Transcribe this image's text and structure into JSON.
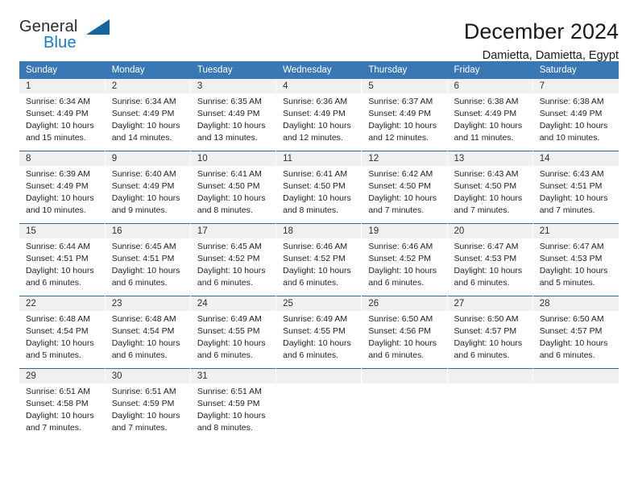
{
  "brand": {
    "name_part1": "General",
    "name_part2": "Blue",
    "triangle_color": "#15659f",
    "blue_color": "#1d7ac4"
  },
  "header": {
    "title": "December 2024",
    "subtitle": "Damietta, Damietta, Egypt"
  },
  "calendar": {
    "header_bg": "#3a78b5",
    "header_text_color": "#ffffff",
    "daynum_bg": "#f0f0f0",
    "weekdays": [
      "Sunday",
      "Monday",
      "Tuesday",
      "Wednesday",
      "Thursday",
      "Friday",
      "Saturday"
    ],
    "weeks": [
      [
        {
          "day": "1",
          "sunrise": "Sunrise: 6:34 AM",
          "sunset": "Sunset: 4:49 PM",
          "daylight1": "Daylight: 10 hours",
          "daylight2": "and 15 minutes."
        },
        {
          "day": "2",
          "sunrise": "Sunrise: 6:34 AM",
          "sunset": "Sunset: 4:49 PM",
          "daylight1": "Daylight: 10 hours",
          "daylight2": "and 14 minutes."
        },
        {
          "day": "3",
          "sunrise": "Sunrise: 6:35 AM",
          "sunset": "Sunset: 4:49 PM",
          "daylight1": "Daylight: 10 hours",
          "daylight2": "and 13 minutes."
        },
        {
          "day": "4",
          "sunrise": "Sunrise: 6:36 AM",
          "sunset": "Sunset: 4:49 PM",
          "daylight1": "Daylight: 10 hours",
          "daylight2": "and 12 minutes."
        },
        {
          "day": "5",
          "sunrise": "Sunrise: 6:37 AM",
          "sunset": "Sunset: 4:49 PM",
          "daylight1": "Daylight: 10 hours",
          "daylight2": "and 12 minutes."
        },
        {
          "day": "6",
          "sunrise": "Sunrise: 6:38 AM",
          "sunset": "Sunset: 4:49 PM",
          "daylight1": "Daylight: 10 hours",
          "daylight2": "and 11 minutes."
        },
        {
          "day": "7",
          "sunrise": "Sunrise: 6:38 AM",
          "sunset": "Sunset: 4:49 PM",
          "daylight1": "Daylight: 10 hours",
          "daylight2": "and 10 minutes."
        }
      ],
      [
        {
          "day": "8",
          "sunrise": "Sunrise: 6:39 AM",
          "sunset": "Sunset: 4:49 PM",
          "daylight1": "Daylight: 10 hours",
          "daylight2": "and 10 minutes."
        },
        {
          "day": "9",
          "sunrise": "Sunrise: 6:40 AM",
          "sunset": "Sunset: 4:49 PM",
          "daylight1": "Daylight: 10 hours",
          "daylight2": "and 9 minutes."
        },
        {
          "day": "10",
          "sunrise": "Sunrise: 6:41 AM",
          "sunset": "Sunset: 4:50 PM",
          "daylight1": "Daylight: 10 hours",
          "daylight2": "and 8 minutes."
        },
        {
          "day": "11",
          "sunrise": "Sunrise: 6:41 AM",
          "sunset": "Sunset: 4:50 PM",
          "daylight1": "Daylight: 10 hours",
          "daylight2": "and 8 minutes."
        },
        {
          "day": "12",
          "sunrise": "Sunrise: 6:42 AM",
          "sunset": "Sunset: 4:50 PM",
          "daylight1": "Daylight: 10 hours",
          "daylight2": "and 7 minutes."
        },
        {
          "day": "13",
          "sunrise": "Sunrise: 6:43 AM",
          "sunset": "Sunset: 4:50 PM",
          "daylight1": "Daylight: 10 hours",
          "daylight2": "and 7 minutes."
        },
        {
          "day": "14",
          "sunrise": "Sunrise: 6:43 AM",
          "sunset": "Sunset: 4:51 PM",
          "daylight1": "Daylight: 10 hours",
          "daylight2": "and 7 minutes."
        }
      ],
      [
        {
          "day": "15",
          "sunrise": "Sunrise: 6:44 AM",
          "sunset": "Sunset: 4:51 PM",
          "daylight1": "Daylight: 10 hours",
          "daylight2": "and 6 minutes."
        },
        {
          "day": "16",
          "sunrise": "Sunrise: 6:45 AM",
          "sunset": "Sunset: 4:51 PM",
          "daylight1": "Daylight: 10 hours",
          "daylight2": "and 6 minutes."
        },
        {
          "day": "17",
          "sunrise": "Sunrise: 6:45 AM",
          "sunset": "Sunset: 4:52 PM",
          "daylight1": "Daylight: 10 hours",
          "daylight2": "and 6 minutes."
        },
        {
          "day": "18",
          "sunrise": "Sunrise: 6:46 AM",
          "sunset": "Sunset: 4:52 PM",
          "daylight1": "Daylight: 10 hours",
          "daylight2": "and 6 minutes."
        },
        {
          "day": "19",
          "sunrise": "Sunrise: 6:46 AM",
          "sunset": "Sunset: 4:52 PM",
          "daylight1": "Daylight: 10 hours",
          "daylight2": "and 6 minutes."
        },
        {
          "day": "20",
          "sunrise": "Sunrise: 6:47 AM",
          "sunset": "Sunset: 4:53 PM",
          "daylight1": "Daylight: 10 hours",
          "daylight2": "and 6 minutes."
        },
        {
          "day": "21",
          "sunrise": "Sunrise: 6:47 AM",
          "sunset": "Sunset: 4:53 PM",
          "daylight1": "Daylight: 10 hours",
          "daylight2": "and 5 minutes."
        }
      ],
      [
        {
          "day": "22",
          "sunrise": "Sunrise: 6:48 AM",
          "sunset": "Sunset: 4:54 PM",
          "daylight1": "Daylight: 10 hours",
          "daylight2": "and 5 minutes."
        },
        {
          "day": "23",
          "sunrise": "Sunrise: 6:48 AM",
          "sunset": "Sunset: 4:54 PM",
          "daylight1": "Daylight: 10 hours",
          "daylight2": "and 6 minutes."
        },
        {
          "day": "24",
          "sunrise": "Sunrise: 6:49 AM",
          "sunset": "Sunset: 4:55 PM",
          "daylight1": "Daylight: 10 hours",
          "daylight2": "and 6 minutes."
        },
        {
          "day": "25",
          "sunrise": "Sunrise: 6:49 AM",
          "sunset": "Sunset: 4:55 PM",
          "daylight1": "Daylight: 10 hours",
          "daylight2": "and 6 minutes."
        },
        {
          "day": "26",
          "sunrise": "Sunrise: 6:50 AM",
          "sunset": "Sunset: 4:56 PM",
          "daylight1": "Daylight: 10 hours",
          "daylight2": "and 6 minutes."
        },
        {
          "day": "27",
          "sunrise": "Sunrise: 6:50 AM",
          "sunset": "Sunset: 4:57 PM",
          "daylight1": "Daylight: 10 hours",
          "daylight2": "and 6 minutes."
        },
        {
          "day": "28",
          "sunrise": "Sunrise: 6:50 AM",
          "sunset": "Sunset: 4:57 PM",
          "daylight1": "Daylight: 10 hours",
          "daylight2": "and 6 minutes."
        }
      ],
      [
        {
          "day": "29",
          "sunrise": "Sunrise: 6:51 AM",
          "sunset": "Sunset: 4:58 PM",
          "daylight1": "Daylight: 10 hours",
          "daylight2": "and 7 minutes."
        },
        {
          "day": "30",
          "sunrise": "Sunrise: 6:51 AM",
          "sunset": "Sunset: 4:59 PM",
          "daylight1": "Daylight: 10 hours",
          "daylight2": "and 7 minutes."
        },
        {
          "day": "31",
          "sunrise": "Sunrise: 6:51 AM",
          "sunset": "Sunset: 4:59 PM",
          "daylight1": "Daylight: 10 hours",
          "daylight2": "and 8 minutes."
        },
        {
          "day": "",
          "sunrise": "",
          "sunset": "",
          "daylight1": "",
          "daylight2": ""
        },
        {
          "day": "",
          "sunrise": "",
          "sunset": "",
          "daylight1": "",
          "daylight2": ""
        },
        {
          "day": "",
          "sunrise": "",
          "sunset": "",
          "daylight1": "",
          "daylight2": ""
        },
        {
          "day": "",
          "sunrise": "",
          "sunset": "",
          "daylight1": "",
          "daylight2": ""
        }
      ]
    ]
  }
}
